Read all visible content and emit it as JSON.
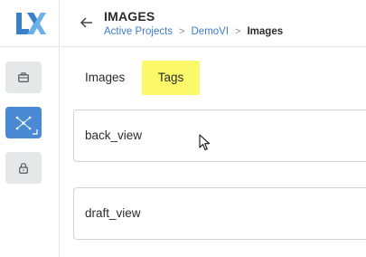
{
  "header": {
    "title": "IMAGES",
    "breadcrumb": {
      "active_projects": "Active Projects",
      "project": "DemoVI",
      "current": "Images"
    }
  },
  "sidebar": {
    "items": [
      {
        "icon": "briefcase-icon",
        "active": false
      },
      {
        "icon": "network-icon",
        "active": true
      },
      {
        "icon": "lock-icon",
        "active": false
      }
    ]
  },
  "tabs": [
    {
      "label": "Images",
      "selected": false
    },
    {
      "label": "Tags",
      "selected": true
    }
  ],
  "tags": [
    {
      "name": "back_view"
    },
    {
      "name": "draft_view"
    }
  ],
  "colors": {
    "accent": "#4a89d4",
    "link": "#3d7cc9",
    "highlight": "#fbf86a",
    "logo_blue": "#3a7fc8",
    "logo_light": "#6ab0e6"
  }
}
